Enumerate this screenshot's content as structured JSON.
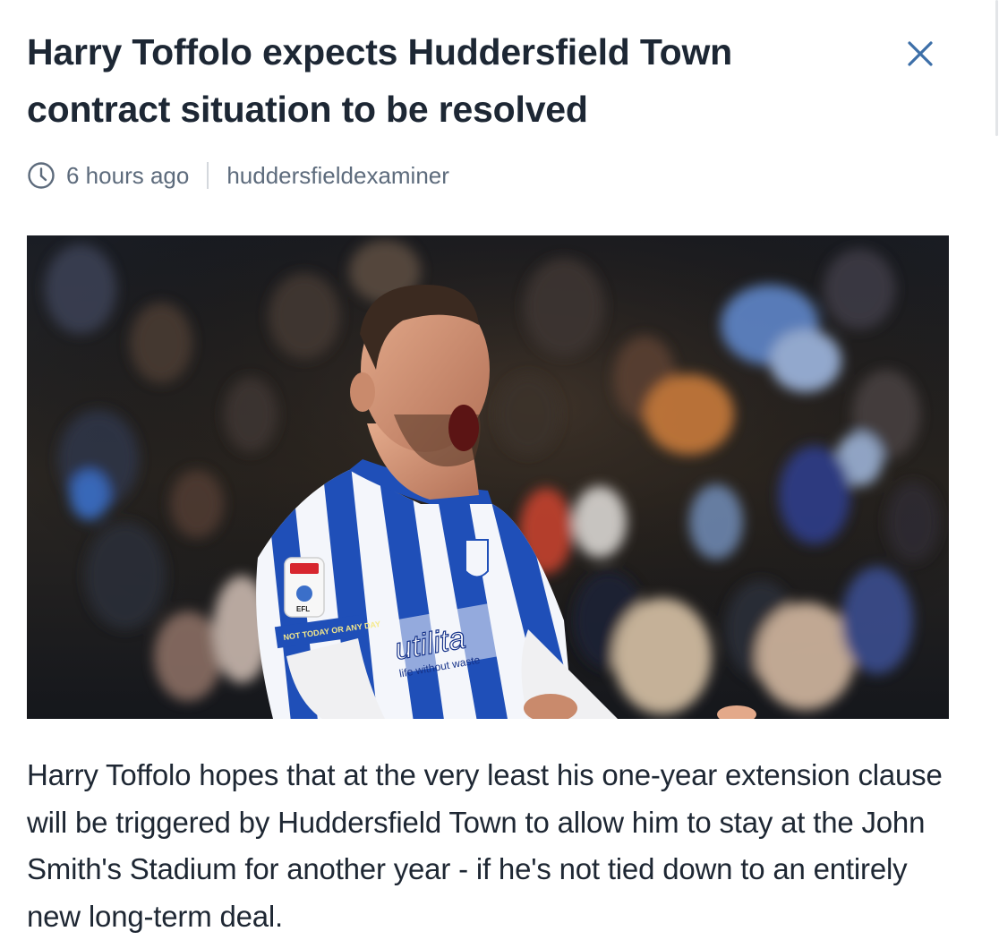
{
  "article": {
    "title": "Harry Toffolo expects Huddersfield Town contract situation to be resolved",
    "time_ago": "6 hours ago",
    "source": "huddersfieldexaminer",
    "body": "Harry Toffolo hopes that at the very least his one-year extension clause will be triggered by Huddersfield Town to allow him to stay at the John Smith's Stadium for another year - if he's not tied down to an entirely new long-term deal.",
    "image": {
      "shirt_sponsor": "utilita",
      "sponsor_tagline": "life without waste",
      "sleeve_text": "NOT TODAY OR ANY DAY",
      "badge": "EFL"
    }
  },
  "icons": {
    "close": "close-icon",
    "clock": "clock-icon"
  },
  "colors": {
    "title": "#1d2734",
    "meta": "#5d6b7c",
    "close_icon": "#3d6fa8",
    "shirt_blue": "#1f4fb8"
  }
}
